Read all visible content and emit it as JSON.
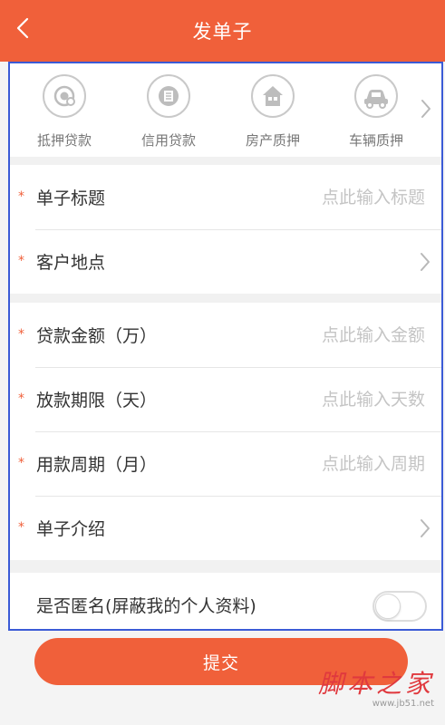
{
  "header": {
    "title": "发单子"
  },
  "categories": [
    {
      "label": "抵押贷款",
      "icon": "mortgage-icon"
    },
    {
      "label": "信用贷款",
      "icon": "credit-icon"
    },
    {
      "label": "房产质押",
      "icon": "house-icon"
    },
    {
      "label": "车辆质押",
      "icon": "car-icon"
    }
  ],
  "form": {
    "title": {
      "label": "单子标题",
      "placeholder": "点此输入标题"
    },
    "location": {
      "label": "客户地点"
    },
    "amount": {
      "label": "贷款金额（万）",
      "placeholder": "点此输入金额"
    },
    "period": {
      "label": "放款期限（天）",
      "placeholder": "点此输入天数"
    },
    "cycle": {
      "label": "用款周期（月）",
      "placeholder": "点此输入周期"
    },
    "intro": {
      "label": "单子介绍"
    },
    "required_mark": "*",
    "anonymous": {
      "label": "是否匿名(屏蔽我的个人资料)",
      "enabled": false
    }
  },
  "submit_label": "提交",
  "watermark": {
    "text": "脚本之家",
    "url": "www.jb51.net"
  },
  "colors": {
    "accent": "#f0603a",
    "frame": "#3b5bd6"
  }
}
